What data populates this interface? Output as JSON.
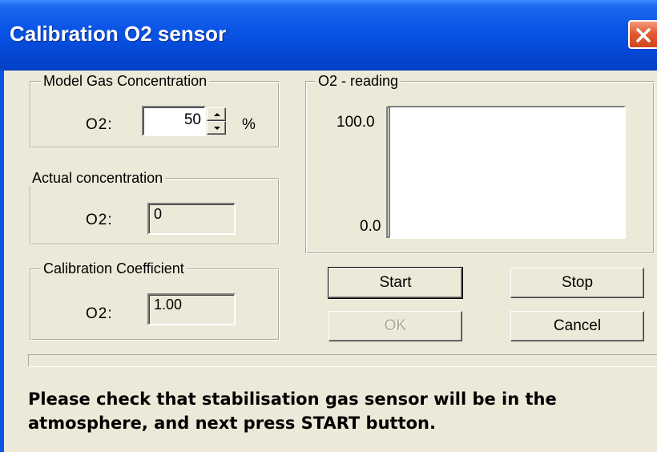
{
  "window": {
    "title": "Calibration O2 sensor",
    "close_icon": "close-icon",
    "colors": {
      "titlebar": "#0A55E6",
      "close": "#E35C33",
      "face": "#ECE9D8"
    }
  },
  "model_gas": {
    "legend": "Model Gas Concentration",
    "label": "O2:",
    "value": "50",
    "unit": "%"
  },
  "actual": {
    "legend": "Actual concentration",
    "label": "O2:",
    "value": "0"
  },
  "coefficient": {
    "legend": "Calibration Coefficient",
    "label": "O2:",
    "value": "1.00"
  },
  "reading": {
    "legend": "O2 - reading"
  },
  "chart_data": {
    "type": "line",
    "title": "",
    "xlabel": "",
    "ylabel": "",
    "ylim": [
      0.0,
      100.0
    ],
    "y_ticks": [
      "100.0",
      "0.0"
    ],
    "series": []
  },
  "buttons": {
    "start": "Start",
    "stop": "Stop",
    "ok": "OK",
    "cancel": "Cancel"
  },
  "progress": {
    "value": 0
  },
  "message": "Please check that stabilisation gas sensor will be in the atmosphere, and next press START button."
}
